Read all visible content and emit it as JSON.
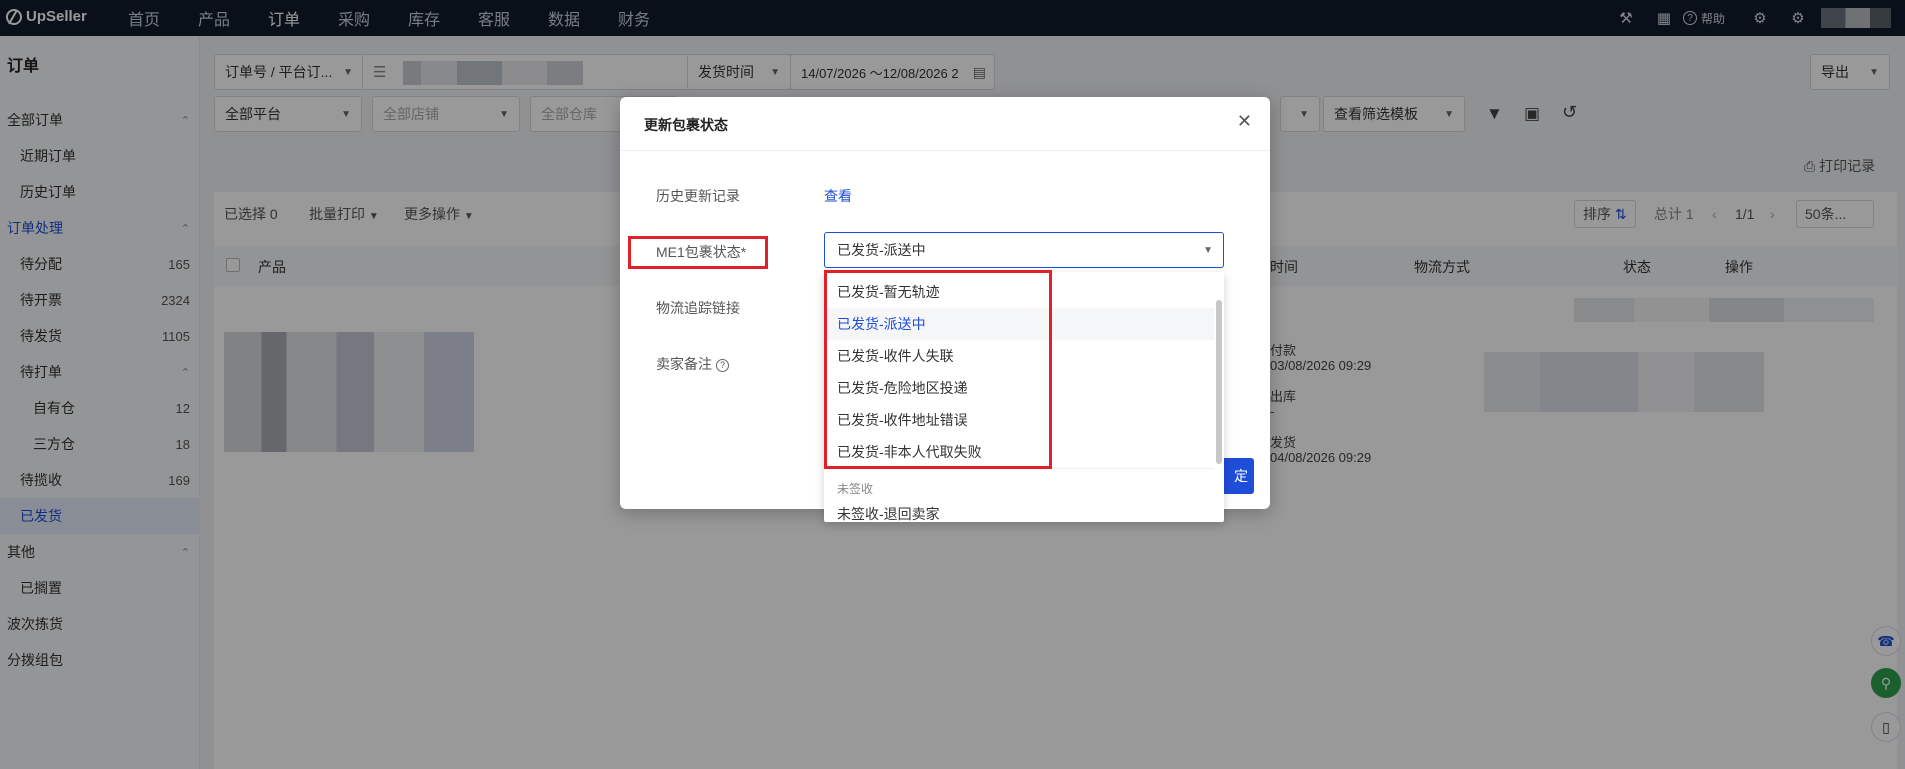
{
  "topnav": {
    "brand": "UpSeller",
    "menu": [
      "首页",
      "产品",
      "订单",
      "采购",
      "库存",
      "客服",
      "数据",
      "财务"
    ],
    "active_index": 2,
    "help_label": "帮助"
  },
  "sidebar": {
    "title": "订单",
    "rows": [
      {
        "label": "全部订单",
        "count": "",
        "chevron": "^",
        "indent": 0,
        "state": "normal"
      },
      {
        "label": "近期订单",
        "count": "",
        "chevron": "",
        "indent": 1,
        "state": "normal"
      },
      {
        "label": "历史订单",
        "count": "",
        "chevron": "",
        "indent": 1,
        "state": "normal"
      },
      {
        "label": "订单处理",
        "count": "",
        "chevron": "^",
        "indent": 0,
        "state": "blue"
      },
      {
        "label": "待分配",
        "count": "165",
        "chevron": "",
        "indent": 1,
        "state": "normal"
      },
      {
        "label": "待开票",
        "count": "2324",
        "chevron": "",
        "indent": 1,
        "state": "normal"
      },
      {
        "label": "待发货",
        "count": "1105",
        "chevron": "",
        "indent": 1,
        "state": "normal"
      },
      {
        "label": "待打单",
        "count": "",
        "chevron": "^",
        "indent": 1,
        "state": "normal"
      },
      {
        "label": "自有仓",
        "count": "12",
        "chevron": "",
        "indent": 2,
        "state": "normal"
      },
      {
        "label": "三方仓",
        "count": "18",
        "chevron": "",
        "indent": 2,
        "state": "normal"
      },
      {
        "label": "待揽收",
        "count": "169",
        "chevron": "",
        "indent": 1,
        "state": "normal"
      },
      {
        "label": "已发货",
        "count": "",
        "chevron": "",
        "indent": 1,
        "state": "selected"
      },
      {
        "label": "其他",
        "count": "",
        "chevron": "^",
        "indent": 0,
        "state": "normal"
      },
      {
        "label": "已搁置",
        "count": "",
        "chevron": "",
        "indent": 1,
        "state": "normal"
      },
      {
        "label": "波次拣货",
        "count": "",
        "chevron": "",
        "indent": 0,
        "state": "normal"
      },
      {
        "label": "分拨组包",
        "count": "",
        "chevron": "",
        "indent": 0,
        "state": "normal"
      }
    ]
  },
  "toolbar": {
    "order_filter": "订单号 / 平台订...",
    "date_type": "发货时间",
    "date_range": "14/07/2026 〜12/08/2026 2",
    "export_label": "导出",
    "platform": "全部平台",
    "shop_placeholder": "全部店铺",
    "warehouse_placeholder": "全部仓库",
    "template": "查看筛选模板",
    "print_log": "打印记录"
  },
  "list": {
    "selected_label": "已选择 0",
    "batch_print": "批量打印",
    "more_actions": "更多操作",
    "sort_label": "排序",
    "total_label": "总计 1",
    "page_label": "1/1",
    "page_size": "50条...",
    "columns": {
      "product": "产品",
      "time": "时间",
      "logistics": "物流方式",
      "status": "状态",
      "action": "操作"
    },
    "row_times": [
      {
        "label": "付款",
        "value": "03/08/2026 09:29"
      },
      {
        "label": "出库",
        "value": "-"
      },
      {
        "label": "发货",
        "value": "04/08/2026 09:29"
      }
    ]
  },
  "modal": {
    "title": "更新包裹状态",
    "history_label": "历史更新记录",
    "history_link": "查看",
    "status_label": "ME1包裹状态",
    "required_mark": "*",
    "status_value": "已发货-派送中",
    "tracking_label": "物流追踪链接",
    "note_label": "卖家备注",
    "confirm_label": "定"
  },
  "dropdown": {
    "options": [
      "已发货-暂无轨迹",
      "已发货-派送中",
      "已发货-收件人失联",
      "已发货-危险地区投递",
      "已发货-收件地址错误",
      "已发货-非本人代取失败"
    ],
    "active_index": 1,
    "group_label": "未签收",
    "group_options": [
      "未签收-退回卖家"
    ]
  },
  "colors": {
    "accent": "#1e4dd8",
    "nav_bg": "#0f1c2c",
    "highlight": "#e0202a"
  }
}
